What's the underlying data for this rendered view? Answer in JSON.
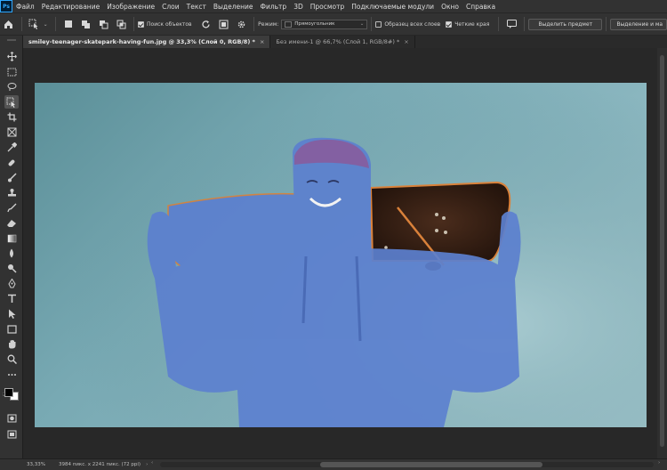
{
  "app": {
    "logo": "Ps"
  },
  "menu": [
    "Файл",
    "Редактирование",
    "Изображение",
    "Слои",
    "Текст",
    "Выделение",
    "Фильтр",
    "3D",
    "Просмотр",
    "Подключаемые модули",
    "Окно",
    "Справка"
  ],
  "options": {
    "sample_all": "Поиск объектов",
    "mode_label": "Режим:",
    "mode_value": "Прямоугольник",
    "sample_all_layers": "Образец всех слоев",
    "sharp_edges": "Четкие края",
    "select_subject": "Выделить предмет",
    "select_and_mask": "Выделение и ма"
  },
  "tabs": [
    {
      "label": "smiley-teenager-skatepark-having-fun.jpg @ 33,3% (Слой 0, RGB/8) *",
      "close": "×"
    },
    {
      "label": "Без имени-1 @ 66,7% (Слой 1, RGB/8#) *",
      "close": "×"
    }
  ],
  "status": {
    "zoom": "33,33%",
    "doc_info": "3984 пикс. x 2241 пикс. (72 ppi)",
    "arrow_left": "‹",
    "arrow_right": "›"
  },
  "colors": {
    "panel": "#323232",
    "canvas_bg": "#282828",
    "photo_bg": "#78a9b3",
    "selection_overlay": "#5b7fd0",
    "skateboard": "#3a2418",
    "accent": "#31a8ff"
  }
}
